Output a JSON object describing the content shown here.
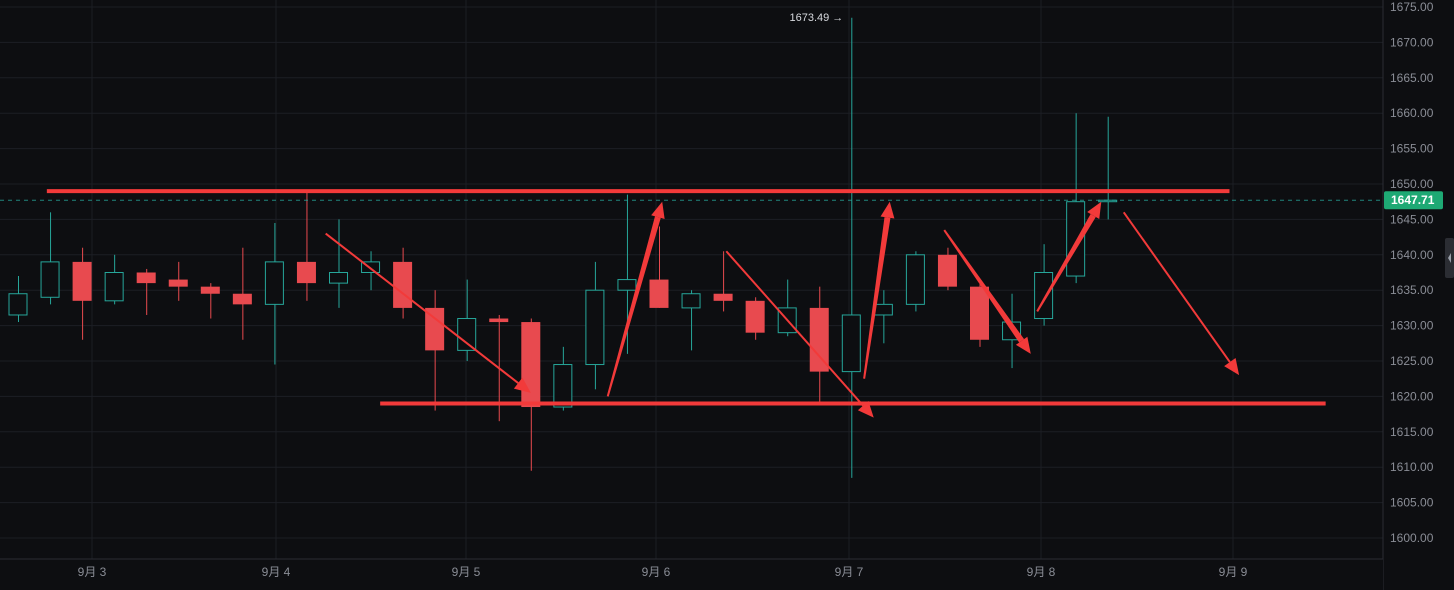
{
  "chart_data": {
    "type": "candlestick",
    "colors": {
      "up": "#26a69a",
      "down": "#e84a4f",
      "annotation": "#f23a3a",
      "grid": "#1c1e24",
      "background": "#0d0e11",
      "price_tag": "#1ea974"
    },
    "ylim": [
      1597,
      1676
    ],
    "y_ticks": [
      "1675.00",
      "1670.00",
      "1665.00",
      "1660.00",
      "1655.00",
      "1650.00",
      "1645.00",
      "1640.00",
      "1635.00",
      "1630.00",
      "1625.00",
      "1620.00",
      "1615.00",
      "1610.00",
      "1605.00",
      "1600.00"
    ],
    "x_ticks": [
      "9月 3",
      "9月 4",
      "9月 5",
      "9月 6",
      "9月 7",
      "9月 8",
      "9月 9"
    ],
    "current_price": "1647.71",
    "high_label": "1673.49",
    "high_arrow": "→",
    "candles": [
      {
        "o": 1631.5,
        "h": 1637.0,
        "l": 1630.5,
        "c": 1634.5
      },
      {
        "o": 1634.0,
        "h": 1646.0,
        "l": 1633.0,
        "c": 1639.0
      },
      {
        "o": 1639.0,
        "h": 1641.0,
        "l": 1628.0,
        "c": 1633.5
      },
      {
        "o": 1633.5,
        "h": 1640.0,
        "l": 1633.0,
        "c": 1637.5
      },
      {
        "o": 1637.5,
        "h": 1638.0,
        "l": 1631.5,
        "c": 1636.0
      },
      {
        "o": 1636.5,
        "h": 1639.0,
        "l": 1633.5,
        "c": 1635.5
      },
      {
        "o": 1635.5,
        "h": 1636.0,
        "l": 1631.0,
        "c": 1634.5
      },
      {
        "o": 1634.5,
        "h": 1641.0,
        "l": 1628.0,
        "c": 1633.0
      },
      {
        "o": 1633.0,
        "h": 1644.5,
        "l": 1624.5,
        "c": 1639.0
      },
      {
        "o": 1639.0,
        "h": 1649.0,
        "l": 1633.5,
        "c": 1636.0
      },
      {
        "o": 1636.0,
        "h": 1645.0,
        "l": 1632.5,
        "c": 1637.5
      },
      {
        "o": 1637.5,
        "h": 1640.5,
        "l": 1635.0,
        "c": 1639.0
      },
      {
        "o": 1639.0,
        "h": 1641.0,
        "l": 1631.0,
        "c": 1632.5
      },
      {
        "o": 1632.5,
        "h": 1635.0,
        "l": 1618.0,
        "c": 1626.5
      },
      {
        "o": 1626.5,
        "h": 1636.5,
        "l": 1625.0,
        "c": 1631.0
      },
      {
        "o": 1631.0,
        "h": 1631.5,
        "l": 1616.5,
        "c": 1630.5
      },
      {
        "o": 1630.5,
        "h": 1631.0,
        "l": 1609.5,
        "c": 1618.5
      },
      {
        "o": 1618.5,
        "h": 1627.0,
        "l": 1618.0,
        "c": 1624.5
      },
      {
        "o": 1624.5,
        "h": 1639.0,
        "l": 1621.0,
        "c": 1635.0
      },
      {
        "o": 1635.0,
        "h": 1648.5,
        "l": 1626.0,
        "c": 1636.5
      },
      {
        "o": 1636.5,
        "h": 1644.0,
        "l": 1632.5,
        "c": 1632.5
      },
      {
        "o": 1632.5,
        "h": 1635.0,
        "l": 1626.5,
        "c": 1634.5
      },
      {
        "o": 1634.5,
        "h": 1640.5,
        "l": 1632.0,
        "c": 1633.5
      },
      {
        "o": 1633.5,
        "h": 1634.0,
        "l": 1628.0,
        "c": 1629.0
      },
      {
        "o": 1629.0,
        "h": 1636.5,
        "l": 1628.5,
        "c": 1632.5
      },
      {
        "o": 1632.5,
        "h": 1635.5,
        "l": 1619.0,
        "c": 1623.5
      },
      {
        "o": 1623.5,
        "h": 1673.49,
        "l": 1608.5,
        "c": 1631.5
      },
      {
        "o": 1631.5,
        "h": 1635.0,
        "l": 1627.5,
        "c": 1633.0
      },
      {
        "o": 1633.0,
        "h": 1640.5,
        "l": 1632.0,
        "c": 1640.0
      },
      {
        "o": 1640.0,
        "h": 1641.0,
        "l": 1635.0,
        "c": 1635.5
      },
      {
        "o": 1635.5,
        "h": 1636.5,
        "l": 1627.0,
        "c": 1628.0
      },
      {
        "o": 1628.0,
        "h": 1634.5,
        "l": 1624.0,
        "c": 1630.5
      },
      {
        "o": 1631.0,
        "h": 1641.5,
        "l": 1630.0,
        "c": 1637.5
      },
      {
        "o": 1637.0,
        "h": 1660.0,
        "l": 1636.0,
        "c": 1647.5
      },
      {
        "o": 1647.5,
        "h": 1659.5,
        "l": 1645.0,
        "c": 1647.71
      }
    ],
    "annotations": {
      "horizontal_lines": [
        {
          "price": 1649.0,
          "from_candle": 0.9,
          "to_candle": 37.8
        },
        {
          "price": 1619.0,
          "from_candle": 11.3,
          "to_candle": 40.8
        }
      ],
      "arrows": [
        {
          "from": [
            9.6,
            1643.0
          ],
          "to": [
            16.0,
            1620.5
          ],
          "width": "thin"
        },
        {
          "from": [
            18.4,
            1620.0
          ],
          "to": [
            20.1,
            1647.5
          ],
          "width": "thick"
        },
        {
          "from": [
            22.1,
            1640.5
          ],
          "to": [
            26.7,
            1617.0
          ],
          "width": "thin"
        },
        {
          "from": [
            26.4,
            1622.5
          ],
          "to": [
            27.2,
            1647.5
          ],
          "width": "thick"
        },
        {
          "from": [
            28.9,
            1643.5
          ],
          "to": [
            31.6,
            1626.0
          ],
          "width": "thick"
        },
        {
          "from": [
            31.8,
            1632.0
          ],
          "to": [
            33.8,
            1647.5
          ],
          "width": "thick"
        },
        {
          "from": [
            34.5,
            1646.0
          ],
          "to": [
            38.1,
            1623.0
          ],
          "width": "thin"
        }
      ]
    }
  }
}
